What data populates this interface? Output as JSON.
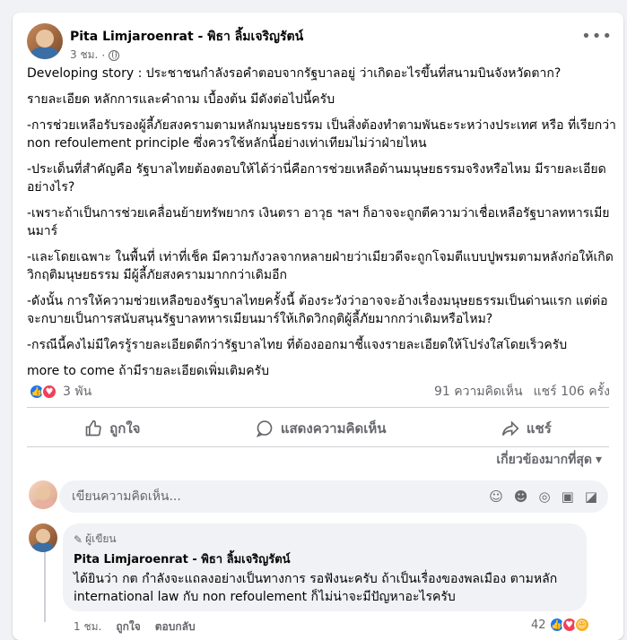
{
  "post": {
    "author": "Pita Limjaroenrat - พิธา ลิ้มเจริญรัตน์",
    "time": "3 ชม.",
    "privacy_icon": "globe-icon",
    "paragraphs": [
      "Developing story : ประชาชนกำลังรอคำตอบจากรัฐบาลอยู่ ว่าเกิดอะไรขึ้นที่สนามบินจังหวัดตาก?",
      "รายละเอียด หลักการและคำถาม เบื้องต้น มีดังต่อไปนี้ครับ",
      "-การช่วยเหลือรับรองผู้ลี้ภัยสงครามตามหลักมนุษยธรรม เป็นสิ่งต้องทำตามพันธะระหว่างประเทศ หรือ ที่เรียกว่า non refoulement principle ซึ่งควรใช้หลักนี้อย่างเท่าเทียมไม่ว่าฝ่ายไหน",
      "-ประเด็นที่สำคัญคือ รัฐบาลไทยต้องตอบให้ได้ว่านี่คือการช่วยเหลือด้านมนุษยธรรมจริงหรือไหม มีรายละเอียดอย่างไร?",
      "-เพราะถ้าเป็นการช่วยเคลื่อนย้ายทรัพยากร เงินตรา อาวุธ ฯลฯ ก็อาจจะถูกตีความว่าเชื่อเหลือรัฐบาลทหารเมียนมาร์",
      "-และโดยเฉพาะ ในพื้นที่ เท่าที่เช็ค มีความกังวลจากหลายฝ่ายว่าเมียวดีจะถูกโจมตีแบบปูพรมตามหลังก่อให้เกิดวิกฤติมนุษยธรรม มีผู้ลี้ภัยสงครามมากกว่าเดิมอีก",
      "-ดังนั้น การให้ความช่วยเหลือของรัฐบาลไทยครั้งนี้ ต้องระวังว่าอาจจะอ้างเรื่องมนุษยธรรมเป็นด่านแรก แต่ต่อจะกบายเป็นการสนับสนุนรัฐบาลทหารเมียนมาร์ให้เกิดวิกฤติผู้ลี้ภัยมากกว่าเดิมหรือไหม?",
      "-กรณีนี้คงไม่มีใครรู้รายละเอียดดีกว่ารัฐบาลไทย ที่ต้องออกมาชี้แจงรายละเอียดให้โปร่งใสโดยเร็วครับ",
      "more to come ถ้ามีรายละเอียดเพิ่มเติมครับ"
    ],
    "reactions_count": "3 พัน",
    "comments_count": "91 ความคิดเห็น",
    "shares_count": "แชร์ 106 ครั้ง"
  },
  "actions": {
    "like": "ถูกใจ",
    "comment": "แสดงความคิดเห็น",
    "share": "แชร์"
  },
  "sort_label": "เกี่ยวข้องมากที่สุด",
  "comment_input": {
    "placeholder": "เขียนความคิดเห็น..."
  },
  "comment": {
    "badge": "ผู้เขียน",
    "author": "Pita Limjaroenrat - พิธา ลิ้มเจริญรัตน์",
    "text": "ได้ยินว่า กต กำลังจะแถลงอย่างเป็นทางการ รอฟังนะครับ ถ้าเป็นเรื่องของพลเมือง ตามหลัก international law กับ non refoulement ก็ไม่น่าจะมีปัญหาอะไรครับ",
    "time": "1 ชม.",
    "like": "ถูกใจ",
    "reply": "ตอบกลับ",
    "reactions": "42"
  },
  "colors": {
    "like_blue": "#1877f2",
    "love_red": "#f33e58",
    "muted": "#65676b"
  }
}
